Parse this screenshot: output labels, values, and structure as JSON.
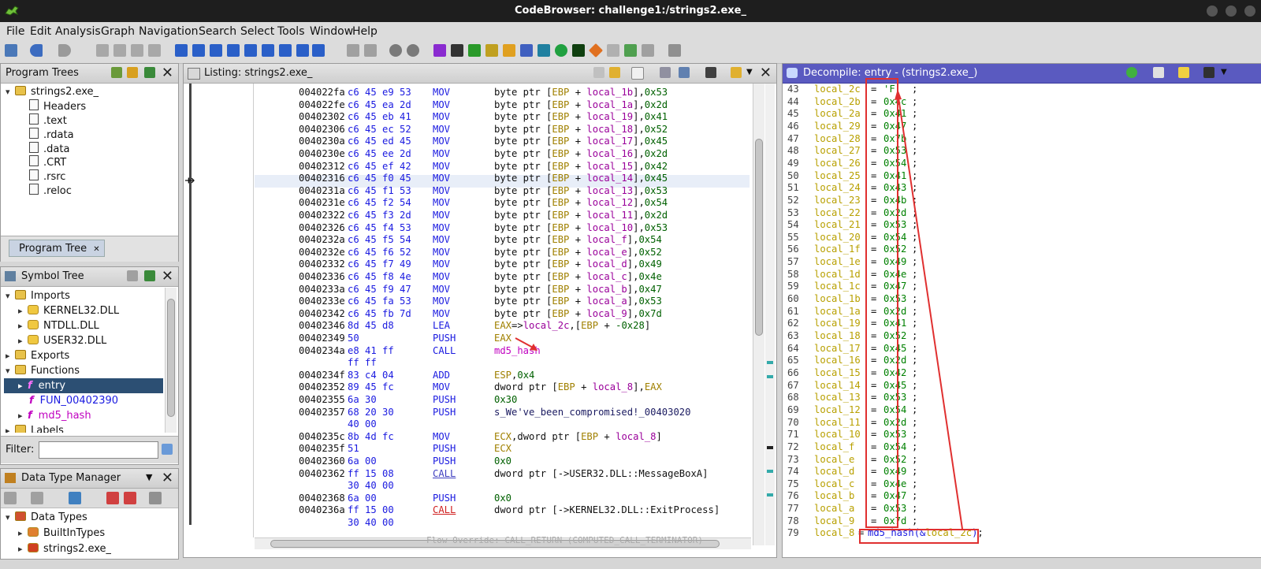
{
  "window": {
    "title": "CodeBrowser: challenge1:/strings2.exe_"
  },
  "menu": [
    "File",
    "Edit",
    "Analysis",
    "Graph",
    "Navigation",
    "Search",
    "Select",
    "Tools",
    "Window",
    "Help"
  ],
  "program_trees": {
    "title": "Program Trees",
    "root": "strings2.exe_",
    "items": [
      "Headers",
      ".text",
      ".rdata",
      ".data",
      ".CRT",
      ".rsrc",
      ".reloc"
    ],
    "tab": "Program Tree"
  },
  "symbol_tree": {
    "title": "Symbol Tree",
    "imports": "Imports",
    "dlls": [
      "KERNEL32.DLL",
      "NTDLL.DLL",
      "USER32.DLL"
    ],
    "exports": "Exports",
    "functions": "Functions",
    "funcs": [
      "entry",
      "FUN_00402390",
      "md5_hash"
    ],
    "labels": "Labels",
    "filter_label": "Filter:",
    "filter_value": ""
  },
  "dtm": {
    "title": "Data Type Manager",
    "root": "Data Types",
    "items": [
      "BuiltInTypes",
      "strings2.exe_"
    ]
  },
  "listing": {
    "title": "Listing:  strings2.exe_",
    "rows": [
      {
        "addr": "004022fa",
        "bytes": "c6 45 e9 53",
        "mn": "MOV",
        "op": "byte ptr [EBP + local_1b],0x53"
      },
      {
        "addr": "004022fe",
        "bytes": "c6 45 ea 2d",
        "mn": "MOV",
        "op": "byte ptr [EBP + local_1a],0x2d"
      },
      {
        "addr": "00402302",
        "bytes": "c6 45 eb 41",
        "mn": "MOV",
        "op": "byte ptr [EBP + local_19],0x41"
      },
      {
        "addr": "00402306",
        "bytes": "c6 45 ec 52",
        "mn": "MOV",
        "op": "byte ptr [EBP + local_18],0x52"
      },
      {
        "addr": "0040230a",
        "bytes": "c6 45 ed 45",
        "mn": "MOV",
        "op": "byte ptr [EBP + local_17],0x45"
      },
      {
        "addr": "0040230e",
        "bytes": "c6 45 ee 2d",
        "mn": "MOV",
        "op": "byte ptr [EBP + local_16],0x2d"
      },
      {
        "addr": "00402312",
        "bytes": "c6 45 ef 42",
        "mn": "MOV",
        "op": "byte ptr [EBP + local_15],0x42"
      },
      {
        "addr": "00402316",
        "bytes": "c6 45 f0 45",
        "mn": "MOV",
        "op": "byte ptr [EBP + local_14],0x45"
      },
      {
        "addr": "0040231a",
        "bytes": "c6 45 f1 53",
        "mn": "MOV",
        "op": "byte ptr [EBP + local_13],0x53"
      },
      {
        "addr": "0040231e",
        "bytes": "c6 45 f2 54",
        "mn": "MOV",
        "op": "byte ptr [EBP + local_12],0x54"
      },
      {
        "addr": "00402322",
        "bytes": "c6 45 f3 2d",
        "mn": "MOV",
        "op": "byte ptr [EBP + local_11],0x2d"
      },
      {
        "addr": "00402326",
        "bytes": "c6 45 f4 53",
        "mn": "MOV",
        "op": "byte ptr [EBP + local_10],0x53"
      },
      {
        "addr": "0040232a",
        "bytes": "c6 45 f5 54",
        "mn": "MOV",
        "op": "byte ptr [EBP + local_f],0x54"
      },
      {
        "addr": "0040232e",
        "bytes": "c6 45 f6 52",
        "mn": "MOV",
        "op": "byte ptr [EBP + local_e],0x52"
      },
      {
        "addr": "00402332",
        "bytes": "c6 45 f7 49",
        "mn": "MOV",
        "op": "byte ptr [EBP + local_d],0x49"
      },
      {
        "addr": "00402336",
        "bytes": "c6 45 f8 4e",
        "mn": "MOV",
        "op": "byte ptr [EBP + local_c],0x4e"
      },
      {
        "addr": "0040233a",
        "bytes": "c6 45 f9 47",
        "mn": "MOV",
        "op": "byte ptr [EBP + local_b],0x47"
      },
      {
        "addr": "0040233e",
        "bytes": "c6 45 fa 53",
        "mn": "MOV",
        "op": "byte ptr [EBP + local_a],0x53"
      },
      {
        "addr": "00402342",
        "bytes": "c6 45 fb 7d",
        "mn": "MOV",
        "op": "byte ptr [EBP + local_9],0x7d"
      },
      {
        "addr": "00402346",
        "bytes": "8d 45 d8",
        "mn": "LEA",
        "op": "EAX=>local_2c,[EBP + -0x28]"
      },
      {
        "addr": "00402349",
        "bytes": "50",
        "mn": "PUSH",
        "op": "EAX"
      },
      {
        "addr": "0040234a",
        "bytes": "e8 41 ff",
        "mn": "CALL",
        "op": "md5_hash"
      },
      {
        "addr": "",
        "bytes": "ff ff",
        "mn": "",
        "op": ""
      },
      {
        "addr": "0040234f",
        "bytes": "83 c4 04",
        "mn": "ADD",
        "op": "ESP,0x4"
      },
      {
        "addr": "00402352",
        "bytes": "89 45 fc",
        "mn": "MOV",
        "op": "dword ptr [EBP + local_8],EAX"
      },
      {
        "addr": "00402355",
        "bytes": "6a 30",
        "mn": "PUSH",
        "op": "0x30"
      },
      {
        "addr": "00402357",
        "bytes": "68 20 30",
        "mn": "PUSH",
        "op": "s_We've_been_compromised!_00403020"
      },
      {
        "addr": "",
        "bytes": "40 00",
        "mn": "",
        "op": ""
      },
      {
        "addr": "0040235c",
        "bytes": "8b 4d fc",
        "mn": "MOV",
        "op": "ECX,dword ptr [EBP + local_8]"
      },
      {
        "addr": "0040235f",
        "bytes": "51",
        "mn": "PUSH",
        "op": "ECX"
      },
      {
        "addr": "00402360",
        "bytes": "6a 00",
        "mn": "PUSH",
        "op": "0x0"
      },
      {
        "addr": "00402362",
        "bytes": "ff 15 08",
        "mn": "CALL",
        "op": "dword ptr [->USER32.DLL::MessageBoxA]"
      },
      {
        "addr": "",
        "bytes": "30 40 00",
        "mn": "",
        "op": ""
      },
      {
        "addr": "00402368",
        "bytes": "6a 00",
        "mn": "PUSH",
        "op": "0x0"
      },
      {
        "addr": "0040236a",
        "bytes": "ff 15 00",
        "mn": "CALL",
        "op": "dword ptr [->KERNEL32.DLL::ExitProcess]"
      },
      {
        "addr": "",
        "bytes": "30 40 00",
        "mn": "",
        "op": ""
      }
    ],
    "footer_comment": "Flow Override: CALL_RETURN (COMPUTED_CALL_TERMINATOR)"
  },
  "decompile": {
    "title": "Decompile: entry -  (strings2.exe_)",
    "lines": [
      {
        "n": "43",
        "v": "local_2c",
        "val": "'F'"
      },
      {
        "n": "44",
        "v": "local_2b",
        "val": "0x4c"
      },
      {
        "n": "45",
        "v": "local_2a",
        "val": "0x41"
      },
      {
        "n": "46",
        "v": "local_29",
        "val": "0x47"
      },
      {
        "n": "47",
        "v": "local_28",
        "val": "0x7b"
      },
      {
        "n": "48",
        "v": "local_27",
        "val": "0x53"
      },
      {
        "n": "49",
        "v": "local_26",
        "val": "0x54"
      },
      {
        "n": "50",
        "v": "local_25",
        "val": "0x41"
      },
      {
        "n": "51",
        "v": "local_24",
        "val": "0x43"
      },
      {
        "n": "52",
        "v": "local_23",
        "val": "0x4b"
      },
      {
        "n": "53",
        "v": "local_22",
        "val": "0x2d"
      },
      {
        "n": "54",
        "v": "local_21",
        "val": "0x53"
      },
      {
        "n": "55",
        "v": "local_20",
        "val": "0x54"
      },
      {
        "n": "56",
        "v": "local_1f",
        "val": "0x52"
      },
      {
        "n": "57",
        "v": "local_1e",
        "val": "0x49"
      },
      {
        "n": "58",
        "v": "local_1d",
        "val": "0x4e"
      },
      {
        "n": "59",
        "v": "local_1c",
        "val": "0x47"
      },
      {
        "n": "60",
        "v": "local_1b",
        "val": "0x53"
      },
      {
        "n": "61",
        "v": "local_1a",
        "val": "0x2d"
      },
      {
        "n": "62",
        "v": "local_19",
        "val": "0x41"
      },
      {
        "n": "63",
        "v": "local_18",
        "val": "0x52"
      },
      {
        "n": "64",
        "v": "local_17",
        "val": "0x45"
      },
      {
        "n": "65",
        "v": "local_16",
        "val": "0x2d"
      },
      {
        "n": "66",
        "v": "local_15",
        "val": "0x42"
      },
      {
        "n": "67",
        "v": "local_14",
        "val": "0x45"
      },
      {
        "n": "68",
        "v": "local_13",
        "val": "0x53"
      },
      {
        "n": "69",
        "v": "local_12",
        "val": "0x54"
      },
      {
        "n": "70",
        "v": "local_11",
        "val": "0x2d"
      },
      {
        "n": "71",
        "v": "local_10",
        "val": "0x53"
      },
      {
        "n": "72",
        "v": "local_f",
        "val": "0x54"
      },
      {
        "n": "73",
        "v": "local_e",
        "val": "0x52"
      },
      {
        "n": "74",
        "v": "local_d",
        "val": "0x49"
      },
      {
        "n": "75",
        "v": "local_c",
        "val": "0x4e"
      },
      {
        "n": "76",
        "v": "local_b",
        "val": "0x47"
      },
      {
        "n": "77",
        "v": "local_a",
        "val": "0x53"
      },
      {
        "n": "78",
        "v": "local_9",
        "val": "0x7d"
      }
    ],
    "last_line": {
      "n": "79",
      "v": "local_8",
      "call": "md5_hash(&local_2c);"
    }
  },
  "colors": {
    "accent": "#2f4f8a",
    "highlight": "#e03030",
    "selection": "#2c4f73"
  }
}
